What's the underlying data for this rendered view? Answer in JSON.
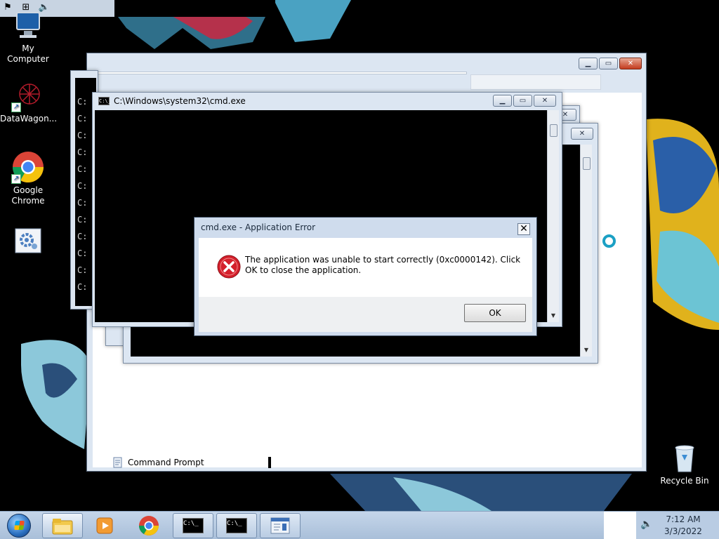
{
  "desktop": {
    "icons": [
      {
        "label": "My Computer"
      },
      {
        "label": "DataWagon..."
      },
      {
        "label": "Google\nChrome"
      },
      {
        "label": ""
      },
      {
        "label": "Recycle Bin"
      }
    ]
  },
  "main_window": {
    "status_label": "Command Prompt"
  },
  "cmd_window": {
    "title": "C:\\Windows\\system32\\cmd.exe",
    "prompt_prefix": "C:"
  },
  "error_dialog": {
    "title": "cmd.exe - Application Error",
    "message": "The application was unable to start correctly (0xc0000142). Click OK to close the application.",
    "ok_label": "OK",
    "close_glyph": "✕"
  },
  "taskbar": {
    "time": "7:12 AM",
    "date": "3/3/2022"
  },
  "icons": {
    "error": "error-circle-icon",
    "minimize": "minimize-icon",
    "maximize": "maximize-icon",
    "close": "close-icon"
  },
  "colors": {
    "window_frame": "#dce6f2",
    "error_red": "#d4202c",
    "console_bg": "#000000",
    "busy_ring": "#1ba0c4"
  }
}
